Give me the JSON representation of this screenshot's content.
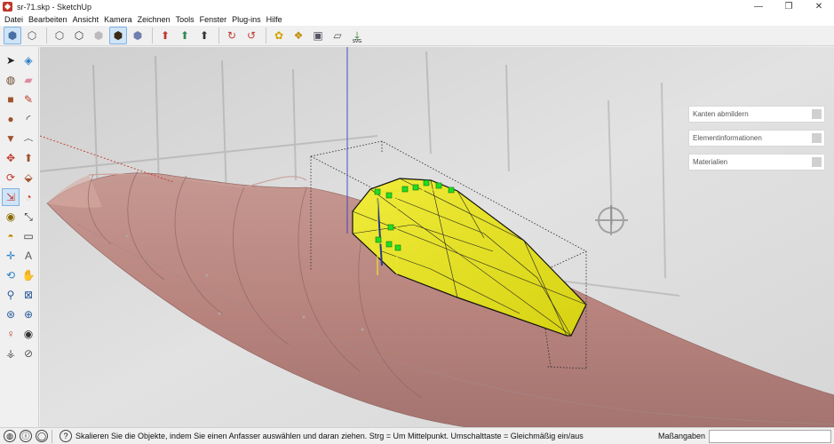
{
  "window": {
    "title": "sr-71.skp - SketchUp",
    "controls": {
      "minimize": "—",
      "maximize": "❐",
      "close": "✕"
    }
  },
  "menu": [
    "Datei",
    "Bearbeiten",
    "Ansicht",
    "Kamera",
    "Zeichnen",
    "Tools",
    "Fenster",
    "Plug-ins",
    "Hilfe"
  ],
  "toolbar": {
    "groups": [
      [
        {
          "icon": "iso-view-icon",
          "glyph": "⬢",
          "color": "#4a6fa5",
          "active": true
        },
        {
          "icon": "wire-cube-icon",
          "glyph": "⬡",
          "color": "#555"
        }
      ],
      [
        {
          "icon": "xray-icon",
          "glyph": "⬡",
          "color": "#555"
        },
        {
          "icon": "hidden-line-icon",
          "glyph": "⬡",
          "color": "#333"
        },
        {
          "icon": "shaded-icon",
          "glyph": "⬢",
          "color": "#bbb"
        },
        {
          "icon": "shaded-textures-icon",
          "glyph": "⬢",
          "color": "#3a2a1a",
          "active": true
        },
        {
          "icon": "monochrome-icon",
          "glyph": "⬢",
          "color": "#6f7fb0"
        }
      ],
      [
        {
          "icon": "axes-red-icon",
          "glyph": "⬆",
          "color": "#c0392b"
        },
        {
          "icon": "axes-green-icon",
          "glyph": "⬆",
          "color": "#2e8b57"
        },
        {
          "icon": "axes-n-icon",
          "glyph": "⬆",
          "color": "#333"
        }
      ],
      [
        {
          "icon": "orbit-icon",
          "glyph": "↻",
          "color": "#c0392b"
        },
        {
          "icon": "pan-icon",
          "glyph": "↺",
          "color": "#c0392b"
        }
      ],
      [
        {
          "icon": "bee-icon",
          "glyph": "✿",
          "color": "#d4a000"
        },
        {
          "icon": "components-icon",
          "glyph": "❖",
          "color": "#c08a00"
        },
        {
          "icon": "warehouse-icon",
          "glyph": "▣",
          "color": "#556"
        },
        {
          "icon": "eraser-small-icon",
          "glyph": "▱",
          "color": "#555"
        },
        {
          "icon": "svg-export-icon",
          "glyph": "⤓",
          "color": "#2e7d32",
          "label": "SVG"
        }
      ]
    ]
  },
  "palette": [
    [
      {
        "icon": "select-arrow-icon",
        "glyph": "➤",
        "color": "#222"
      },
      {
        "icon": "make-component-icon",
        "glyph": "◈",
        "color": "#2a7fc4"
      }
    ],
    [
      {
        "icon": "paint-bucket-icon",
        "glyph": "◍",
        "color": "#6a4a2a"
      },
      {
        "icon": "eraser-icon",
        "glyph": "▰",
        "color": "#e08aa0"
      }
    ],
    [
      {
        "icon": "rectangle-icon",
        "glyph": "■",
        "color": "#a0522d"
      },
      {
        "icon": "pencil-icon",
        "glyph": "✎",
        "color": "#c0392b"
      }
    ],
    [
      {
        "icon": "circle-icon",
        "glyph": "●",
        "color": "#a0522d"
      },
      {
        "icon": "arc-icon",
        "glyph": "◜",
        "color": "#333"
      }
    ],
    [
      {
        "icon": "polygon-icon",
        "glyph": "▼",
        "color": "#a0522d"
      },
      {
        "icon": "freehand-icon",
        "glyph": "෴",
        "color": "#333"
      }
    ],
    [
      {
        "icon": "move-icon",
        "glyph": "✥",
        "color": "#c0392b"
      },
      {
        "icon": "push-pull-icon",
        "glyph": "⬆",
        "color": "#a0522d"
      }
    ],
    [
      {
        "icon": "rotate-icon",
        "glyph": "⟳",
        "color": "#c0392b"
      },
      {
        "icon": "follow-me-icon",
        "glyph": "⬙",
        "color": "#a0522d"
      }
    ],
    [
      {
        "icon": "scale-icon",
        "glyph": "⇲",
        "color": "#c0392b",
        "active": true
      },
      {
        "icon": "offset-icon",
        "glyph": "◔",
        "color": "#c0392b"
      }
    ],
    [
      {
        "icon": "tape-measure-icon",
        "glyph": "◉",
        "color": "#8a6a00"
      },
      {
        "icon": "dimension-icon",
        "glyph": "⤡",
        "color": "#333"
      }
    ],
    [
      {
        "icon": "protractor-icon",
        "glyph": "◓",
        "color": "#c08a00"
      },
      {
        "icon": "text-icon",
        "glyph": "▭",
        "color": "#333"
      }
    ],
    [
      {
        "icon": "axes-icon",
        "glyph": "✛",
        "color": "#2a7fc4"
      },
      {
        "icon": "3d-text-icon",
        "glyph": "A",
        "color": "#555"
      }
    ],
    [
      {
        "icon": "orbit-tool-icon",
        "glyph": "⟲",
        "color": "#2a7fc4"
      },
      {
        "icon": "pan-hand-icon",
        "glyph": "✋",
        "color": "#555"
      }
    ],
    [
      {
        "icon": "zoom-icon",
        "glyph": "⚲",
        "color": "#2a5a9a"
      },
      {
        "icon": "zoom-window-icon",
        "glyph": "⊠",
        "color": "#2a5a9a"
      }
    ],
    [
      {
        "icon": "zoom-extents-icon",
        "glyph": "⊛",
        "color": "#2a5a9a"
      },
      {
        "icon": "previous-view-icon",
        "glyph": "⊕",
        "color": "#2a5a9a"
      }
    ],
    [
      {
        "icon": "position-camera-icon",
        "glyph": "♀",
        "color": "#c0392b"
      },
      {
        "icon": "look-around-icon",
        "glyph": "◉",
        "color": "#333"
      }
    ],
    [
      {
        "icon": "walk-icon",
        "glyph": "⚶",
        "color": "#555"
      },
      {
        "icon": "section-plane-icon",
        "glyph": "⊘",
        "color": "#555"
      }
    ]
  ],
  "tray": {
    "panels": [
      {
        "label": "Kanten abmildern"
      },
      {
        "label": "Elementinformationen"
      },
      {
        "label": "Materialien"
      }
    ]
  },
  "status": {
    "hint": "Skalieren Sie die Objekte, indem Sie einen Anfasser auswählen und daran ziehen. Strg = Um Mittelpunkt. Umschalttaste = Gleichmäßig ein/aus",
    "measure_label": "Maßangaben",
    "measure_value": "",
    "icons": [
      {
        "icon": "geo-location-icon",
        "glyph": "◍"
      },
      {
        "icon": "credits-icon",
        "glyph": "ⓘ"
      },
      {
        "icon": "login-icon",
        "glyph": "◯"
      },
      {
        "icon": "help-icon",
        "glyph": "?"
      }
    ]
  },
  "colors": {
    "fuselage": "#b98680",
    "fuselage_shadow": "#9c6a66",
    "selected_part": "#e6e21e",
    "grip": "#22dd22",
    "axis_blue": "#3a3ad0",
    "axis_red": "#c0392b"
  }
}
